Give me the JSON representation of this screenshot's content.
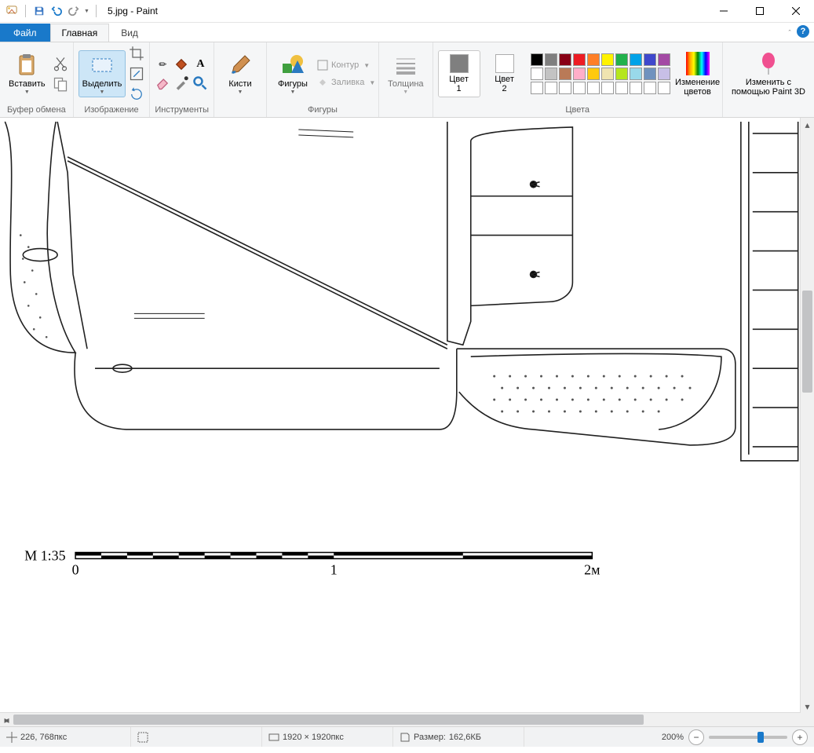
{
  "title": "5.jpg - Paint",
  "tabs": {
    "file": "Файл",
    "home": "Главная",
    "view": "Вид"
  },
  "groups": {
    "clipboard": {
      "label": "Буфер обмена",
      "paste": "Вставить"
    },
    "image": {
      "label": "Изображение",
      "select": "Выделить"
    },
    "tools": {
      "label": "Инструменты"
    },
    "brushes": {
      "label": "Кисти"
    },
    "shapes": {
      "label": "Фигуры",
      "outline": "Контур",
      "fill": "Заливка",
      "big": "Фигуры"
    },
    "thickness": {
      "label": "Толщина"
    },
    "color1": {
      "label": "Цвет\n1"
    },
    "color2": {
      "label": "Цвет\n2"
    },
    "colors": {
      "label": "Цвета"
    },
    "editcolors": {
      "label": "Изменение\nцветов"
    },
    "paint3d": {
      "label": "Изменить с\nпомощью Paint 3D"
    }
  },
  "status": {
    "coords": "226, 768пкс",
    "dims": "1920 × 1920пкс",
    "size_label": "Размер:",
    "size_value": "162,6КБ",
    "zoom": "200%"
  },
  "canvas_content": {
    "scale_label": "М 1:35",
    "scale_values": [
      "0",
      "1",
      "2м"
    ]
  },
  "palette": {
    "row1": [
      "#000000",
      "#7f7f7f",
      "#880015",
      "#ed1c24",
      "#ff7f27",
      "#fff200",
      "#22b14c",
      "#00a2e8",
      "#3f48cc",
      "#a349a4"
    ],
    "row2": [
      "#ffffff",
      "#c3c3c3",
      "#b97a57",
      "#ffaec9",
      "#ffc90e",
      "#efe4b0",
      "#b5e61d",
      "#99d9ea",
      "#7092be",
      "#c8bfe7"
    ],
    "row3": [
      "#ffffff",
      "#ffffff",
      "#ffffff",
      "#ffffff",
      "#ffffff",
      "#ffffff",
      "#ffffff",
      "#ffffff",
      "#ffffff",
      "#ffffff"
    ]
  }
}
